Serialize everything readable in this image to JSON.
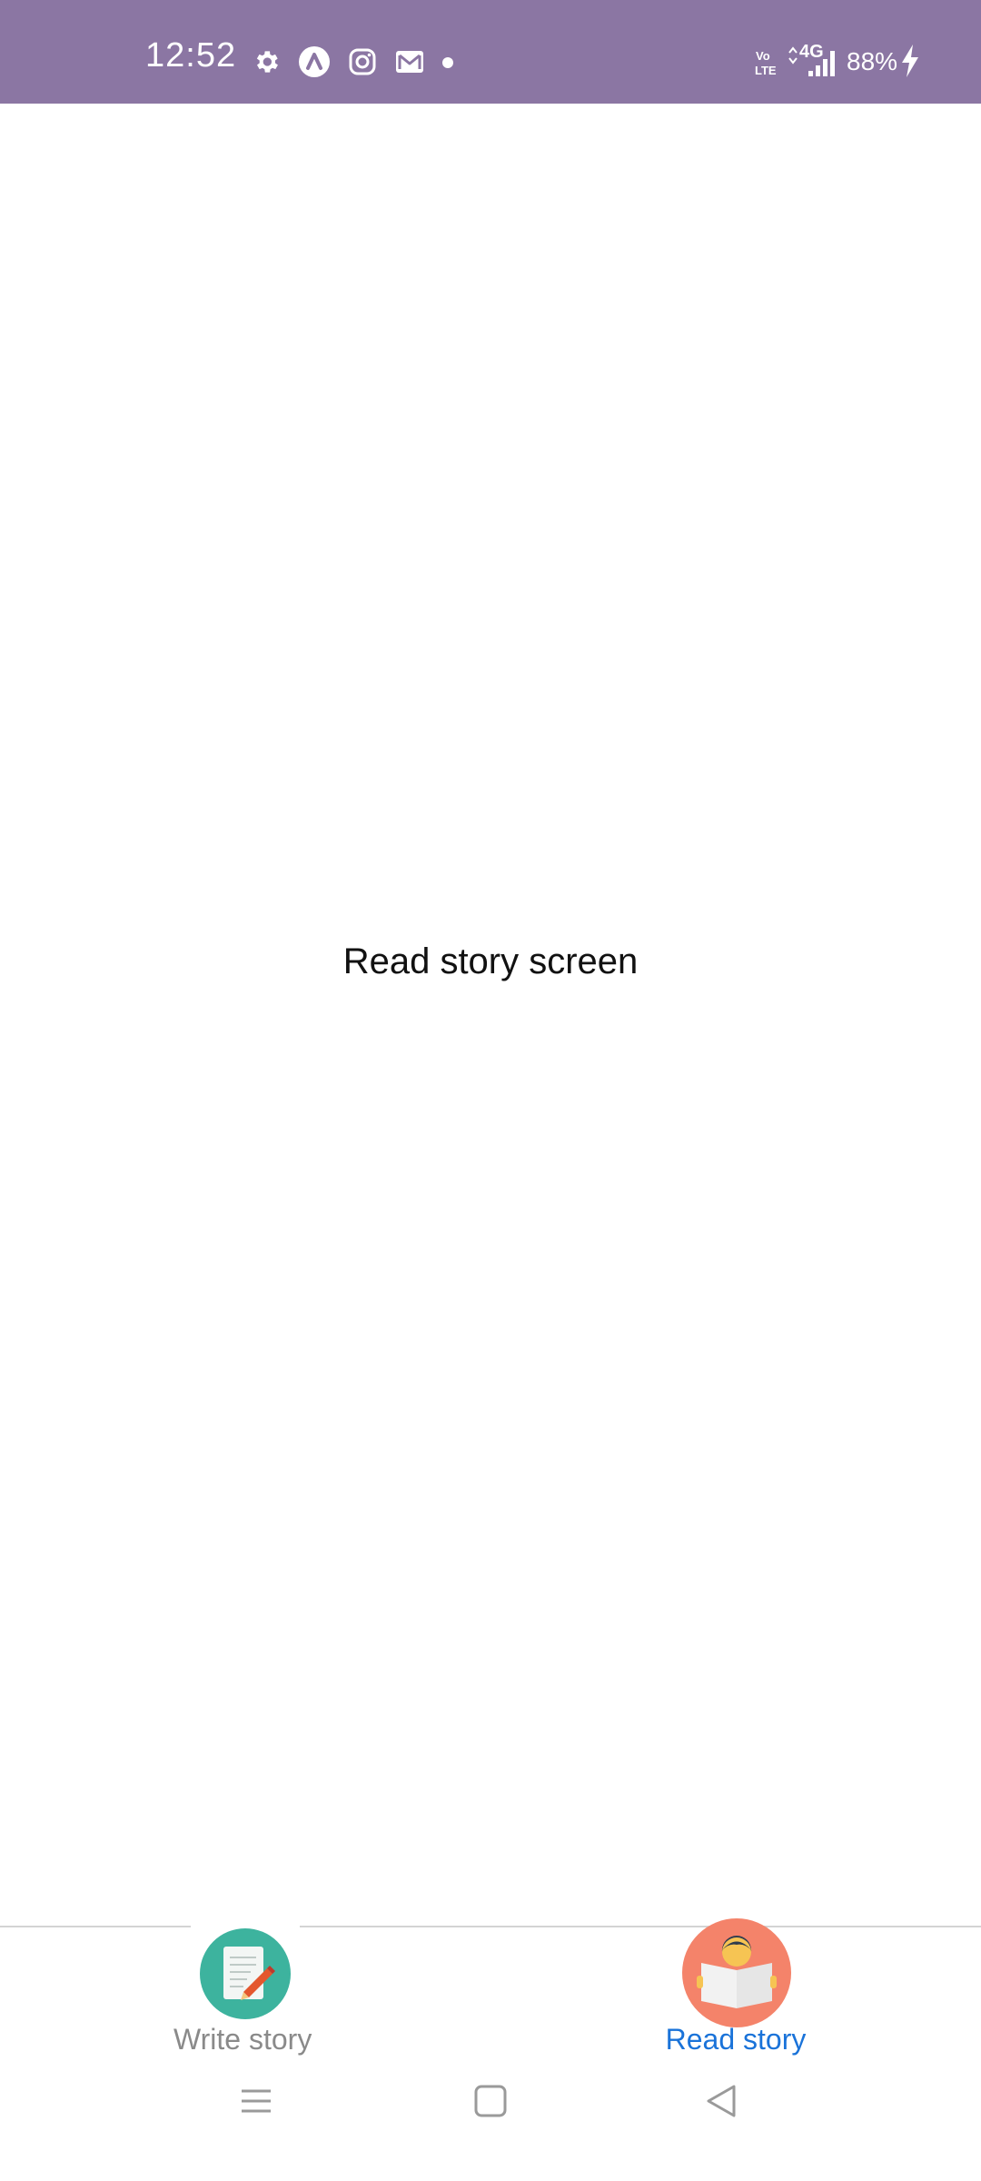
{
  "status_bar": {
    "time": "12:52",
    "battery": "88%",
    "network": "4G",
    "icons": [
      "gear-icon",
      "app-a-icon",
      "instagram-icon",
      "gmail-icon",
      "dot-icon",
      "volte-icon",
      "signal-icon",
      "charging-icon"
    ],
    "background_color": "#8b76a3"
  },
  "screen": {
    "title": "Read story screen"
  },
  "tabs": [
    {
      "label": "Write story",
      "icon": "document-pencil-icon",
      "active": false,
      "color": "#8a8a8a",
      "icon_bg": "#3db39e"
    },
    {
      "label": "Read story",
      "icon": "reader-icon",
      "active": true,
      "color": "#1a73d9",
      "icon_bg": "#f4836a"
    }
  ],
  "navigation": {
    "buttons": [
      "menu-icon",
      "home-icon",
      "back-icon"
    ]
  }
}
